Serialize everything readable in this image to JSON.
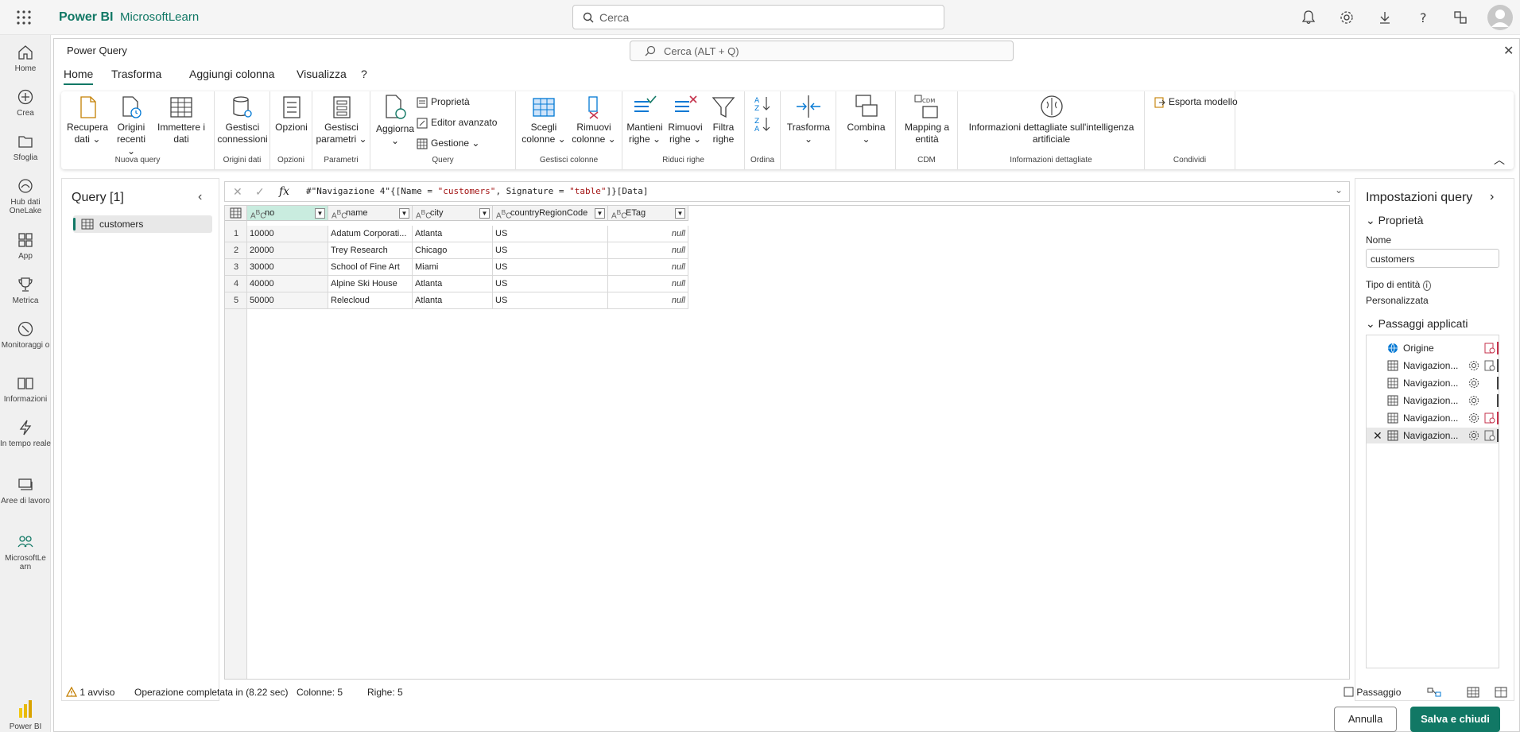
{
  "app": {
    "brand": "Power BI",
    "workspace": "MicrosoftLearn"
  },
  "topbar": {
    "search_placeholder": "Cerca"
  },
  "leftnav": [
    {
      "label": "Home",
      "icon": "home-icon"
    },
    {
      "label": "Crea",
      "icon": "create-icon"
    },
    {
      "label": "Sfoglia",
      "icon": "browse-icon"
    },
    {
      "label": "Hub dati OneLake",
      "icon": "onelake-icon"
    },
    {
      "label": "App",
      "icon": "apps-icon"
    },
    {
      "label": "Metrica",
      "icon": "trophy-icon"
    },
    {
      "label": "Monitoraggi o",
      "icon": "monitor-icon"
    },
    {
      "label": "Informazioni",
      "icon": "book-icon"
    },
    {
      "label": "In tempo reale",
      "icon": "lightning-icon"
    },
    {
      "label": "Aree di lavoro",
      "icon": "workspaces-icon"
    },
    {
      "label": "MicrosoftLe arn",
      "icon": "workspace-people-icon"
    },
    {
      "label": "Power BI",
      "icon": "powerbi-logo-icon"
    }
  ],
  "powerquery": {
    "title": "Power Query",
    "search_placeholder": "Cerca (ALT + Q)",
    "tabs": [
      "Home",
      "Trasforma",
      "Aggiungi colonna",
      "Visualizza",
      "?"
    ]
  },
  "ribbon": {
    "groups": {
      "nuova_query": "Nuova query",
      "origini_dati": "Origini dati",
      "opzioni": "Opzioni",
      "parametri": "Parametri",
      "query": "Query",
      "gestisci_colonne": "Gestisci colonne",
      "riduci_righe": "Riduci righe",
      "ordina": "Ordina",
      "cdm": "CDM",
      "info": "Informazioni dettagliate",
      "condividi": "Condividi"
    },
    "buttons": {
      "recupera_dati": "Recupera dati",
      "origini_recenti": "Origini recenti",
      "immettere_dati": "Immettere i dati",
      "gestisci_connessioni": "Gestisci connessioni",
      "opzioni": "Opzioni",
      "gestisci_parametri": "Gestisci parametri",
      "aggiorna": "Aggiorna",
      "proprieta": "Proprietà",
      "editor_avanzato": "Editor avanzato",
      "gestione": "Gestione",
      "scegli_colonne": "Scegli colonne",
      "rimuovi_colonne": "Rimuovi colonne",
      "mantieni_righe": "Mantieni righe",
      "rimuovi_righe": "Rimuovi righe",
      "filtra_righe": "Filtra righe",
      "trasforma": "Trasforma",
      "combina": "Combina",
      "mapping_entita": "Mapping a entità",
      "info_ai": "Informazioni dettagliate sull'intelligenza artificiale",
      "esporta_modello": "Esporta modello"
    }
  },
  "queries": {
    "title": "Query [1]",
    "items": [
      "customers"
    ]
  },
  "formula": {
    "prefix": "#\"Navigazione 4\"{[Name = ",
    "s1": "\"customers\"",
    "mid": ", Signature = ",
    "s2": "\"table\"",
    "suffix": "]}[Data]"
  },
  "table": {
    "columns": [
      "no",
      "name",
      "city",
      "countryRegionCode",
      "ETag"
    ],
    "type_label": "ABC",
    "rows": [
      [
        "1",
        "10000",
        "Adatum Corporati...",
        "Atlanta",
        "US",
        "null"
      ],
      [
        "2",
        "20000",
        "Trey Research",
        "Chicago",
        "US",
        "null"
      ],
      [
        "3",
        "30000",
        "School of Fine Art",
        "Miami",
        "US",
        "null"
      ],
      [
        "4",
        "40000",
        "Alpine Ski House",
        "Atlanta",
        "US",
        "null"
      ],
      [
        "5",
        "50000",
        "Relecloud",
        "Atlanta",
        "US",
        "null"
      ]
    ]
  },
  "settings": {
    "title": "Impostazioni query",
    "properties": "Proprietà",
    "name_label": "Nome",
    "name_value": "customers",
    "entity_type_label": "Tipo di entità",
    "entity_type_value": "Personalizzata",
    "applied_steps": "Passaggi applicati",
    "steps": [
      "Origine",
      "Navigazion...",
      "Navigazion...",
      "Navigazion...",
      "Navigazion...",
      "Navigazion..."
    ]
  },
  "status": {
    "warnings": "1 avviso",
    "completed": "Operazione completata in (8.22 sec)",
    "columns": "Colonne: 5",
    "rows": "Righe: 5",
    "step_view": "Passaggio"
  },
  "footer": {
    "cancel": "Annulla",
    "save": "Salva e chiudi"
  },
  "colors": {
    "accent": "#117865",
    "selected_header": "#c9ecdf",
    "warning": "#c47f00",
    "error_icon": "#c4314b"
  }
}
